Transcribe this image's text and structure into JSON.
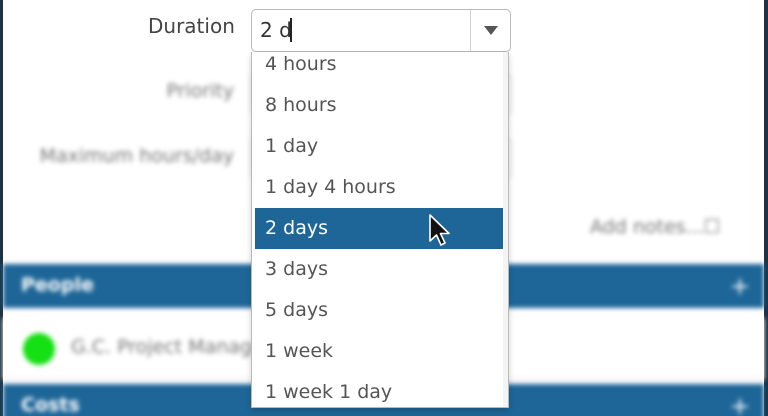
{
  "form": {
    "duration_label": "Duration",
    "duration_value": "2 d",
    "priority_label": "Priority",
    "max_hours_label": "Maximum hours/day",
    "notes_link": "Add notes...☐"
  },
  "dropdown": {
    "options": [
      {
        "label": "4 hours"
      },
      {
        "label": "8 hours"
      },
      {
        "label": "1 day"
      },
      {
        "label": "1 day 4 hours"
      },
      {
        "label": "2 days"
      },
      {
        "label": "3 days"
      },
      {
        "label": "5 days"
      },
      {
        "label": "1 week"
      },
      {
        "label": "1 week 1 day"
      }
    ],
    "selected": "2 days"
  },
  "sections": {
    "people_title": "People",
    "people_add": "+",
    "person_name": "G.C. Project Manager",
    "costs_title": "Costs",
    "costs_add": "+"
  },
  "colors": {
    "accent": "#1e6698",
    "status_online": "#14e014"
  }
}
